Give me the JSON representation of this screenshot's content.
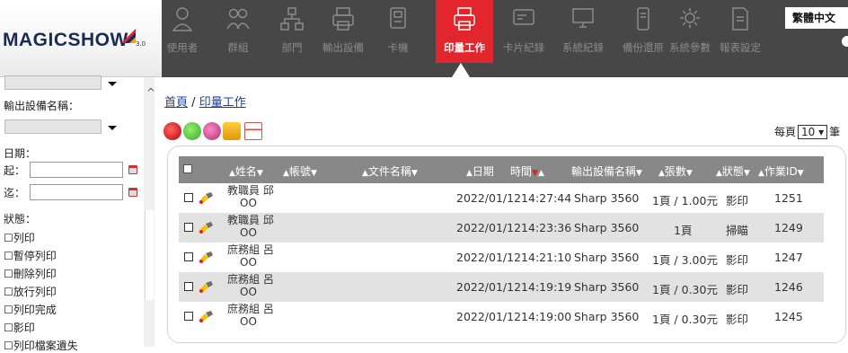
{
  "app": {
    "logo": "MAGICSHOW",
    "version": "3.0",
    "language_button": "繁體中文"
  },
  "nav": {
    "items": [
      {
        "label": "使用者",
        "icon": "user-icon"
      },
      {
        "label": "群組",
        "icon": "group-icon"
      },
      {
        "label": "部門",
        "icon": "department-icon"
      },
      {
        "label": "輸出設備",
        "icon": "output-device-icon"
      },
      {
        "label": "卡機",
        "icon": "card-reader-icon"
      },
      {
        "label": "印量工作",
        "icon": "print-job-icon",
        "active": true
      },
      {
        "label": "卡片紀錄",
        "icon": "card-log-icon"
      },
      {
        "label": "系統紀錄",
        "icon": "system-log-icon"
      },
      {
        "label": "備份還原",
        "icon": "backup-icon"
      },
      {
        "label": "系統參數",
        "icon": "gear-icon"
      },
      {
        "label": "報表設定",
        "icon": "report-icon"
      }
    ]
  },
  "sidebar": {
    "device_label": "輸出設備名稱：",
    "date_label": "日期：",
    "from_label": "起：",
    "to_label": "迄：",
    "status_label": "狀態：",
    "status_options": [
      "列印",
      "暫停列印",
      "刪除列印",
      "放行列印",
      "列印完成",
      "影印",
      "列印檔案遺失"
    ]
  },
  "breadcrumb": {
    "home": "首頁",
    "separator": "/",
    "current": "印量工作"
  },
  "paging": {
    "label_before": "每頁",
    "value": "10",
    "label_after": "筆"
  },
  "table": {
    "headers": {
      "name": "姓名",
      "account": "帳號",
      "doc": "文件名稱",
      "date": "日期",
      "time": "時間",
      "device": "輸出設備名稱",
      "pages": "張數",
      "status": "狀態",
      "job_id": "作業ID"
    },
    "rows": [
      {
        "name1": "教職員 邱",
        "name2": "OO",
        "date": "2022/01/12",
        "time": "14:27:44",
        "device": "Sharp 3560",
        "pages": "1頁 / 1.00元",
        "status": "影印",
        "id": "1251"
      },
      {
        "name1": "教職員 邱",
        "name2": "OO",
        "date": "2022/01/12",
        "time": "14:23:36",
        "device": "Sharp 3560",
        "pages": "1頁",
        "status": "掃瞄",
        "id": "1249"
      },
      {
        "name1": "庶務組 呂",
        "name2": "OO",
        "date": "2022/01/12",
        "time": "14:21:10",
        "device": "Sharp 3560",
        "pages": "1頁 / 3.00元",
        "status": "影印",
        "id": "1247"
      },
      {
        "name1": "庶務組 呂",
        "name2": "OO",
        "date": "2022/01/12",
        "time": "14:19:19",
        "device": "Sharp 3560",
        "pages": "1頁 / 0.30元",
        "status": "影印",
        "id": "1246"
      },
      {
        "name1": "庶務組 呂",
        "name2": "OO",
        "date": "2022/01/12",
        "time": "14:19:00",
        "device": "Sharp 3560",
        "pages": "1頁 / 0.30元",
        "status": "影印",
        "id": "1245"
      }
    ]
  }
}
